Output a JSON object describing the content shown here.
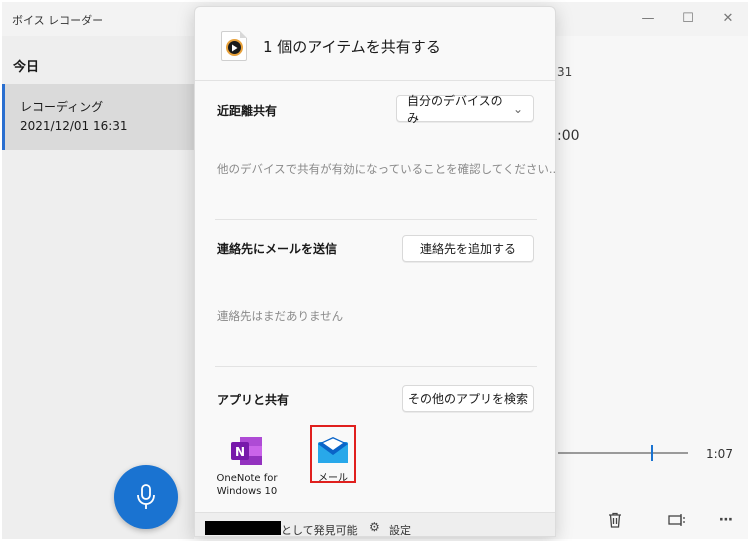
{
  "window": {
    "title": "ボイス レコーダー",
    "minimize": "—",
    "maximize": "☐",
    "close": "✕"
  },
  "sidebar": {
    "group_header": "今日",
    "recording": {
      "name": "レコーディング",
      "date": "2021/12/01 16:31"
    }
  },
  "main": {
    "peek_date_fragment": "31",
    "peek_time_fragment": ":00",
    "total_time": "1:07",
    "bottom_icons": [
      "delete-icon",
      "trim-icon",
      "more-icon"
    ],
    "more_label": "⋯"
  },
  "share": {
    "title": "1 個のアイテムを共有する",
    "nearby": {
      "label": "近距離共有",
      "dropdown_value": "自分のデバイスのみ",
      "dropdown_arrow": "⌄",
      "message": "他のデバイスで共有が有効になっていることを確認してください..."
    },
    "contacts": {
      "label": "連絡先にメールを送信",
      "add_button": "連絡先を追加する",
      "message": "連絡先はまだありません"
    },
    "apps": {
      "label": "アプリと共有",
      "find_button": "その他のアプリを検索",
      "items": [
        {
          "name": "OneNote for Windows 10",
          "label_line1": "OneNote for",
          "label_line2": "Windows 10",
          "icon": "onenote-icon"
        },
        {
          "name": "メール",
          "label": "メール",
          "icon": "mail-icon"
        }
      ]
    },
    "footer": {
      "discoverable_text": "として発見可能",
      "settings_label": "設定",
      "gear": "⚙"
    }
  },
  "colors": {
    "accent": "#1a73d1",
    "highlight_box": "#e0201e",
    "onenote": "#7719aa",
    "mail": "#0a64c8"
  }
}
